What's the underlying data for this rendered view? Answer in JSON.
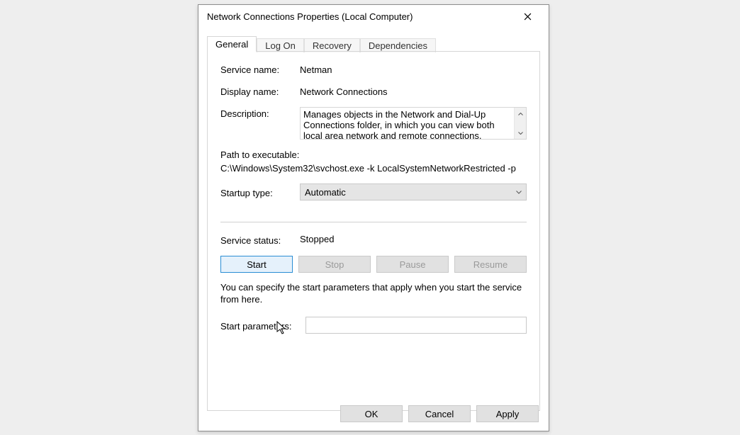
{
  "title": "Network Connections Properties (Local Computer)",
  "tabs": [
    "General",
    "Log On",
    "Recovery",
    "Dependencies"
  ],
  "activeTab": 0,
  "labels": {
    "serviceName": "Service name:",
    "displayName": "Display name:",
    "description": "Description:",
    "pathLabel": "Path to executable:",
    "startupType": "Startup type:",
    "serviceStatus": "Service status:",
    "hint": "You can specify the start parameters that apply when you start the service from here.",
    "startParams": "Start parameters:"
  },
  "values": {
    "serviceName": "Netman",
    "displayName": "Network Connections",
    "description": "Manages objects in the Network and Dial-Up Connections folder, in which you can view both local area network and remote connections.",
    "path": "C:\\Windows\\System32\\svchost.exe -k LocalSystemNetworkRestricted -p",
    "startupType": "Automatic",
    "serviceStatus": "Stopped",
    "startParams": ""
  },
  "buttons": {
    "start": "Start",
    "stop": "Stop",
    "pause": "Pause",
    "resume": "Resume",
    "ok": "OK",
    "cancel": "Cancel",
    "apply": "Apply"
  }
}
